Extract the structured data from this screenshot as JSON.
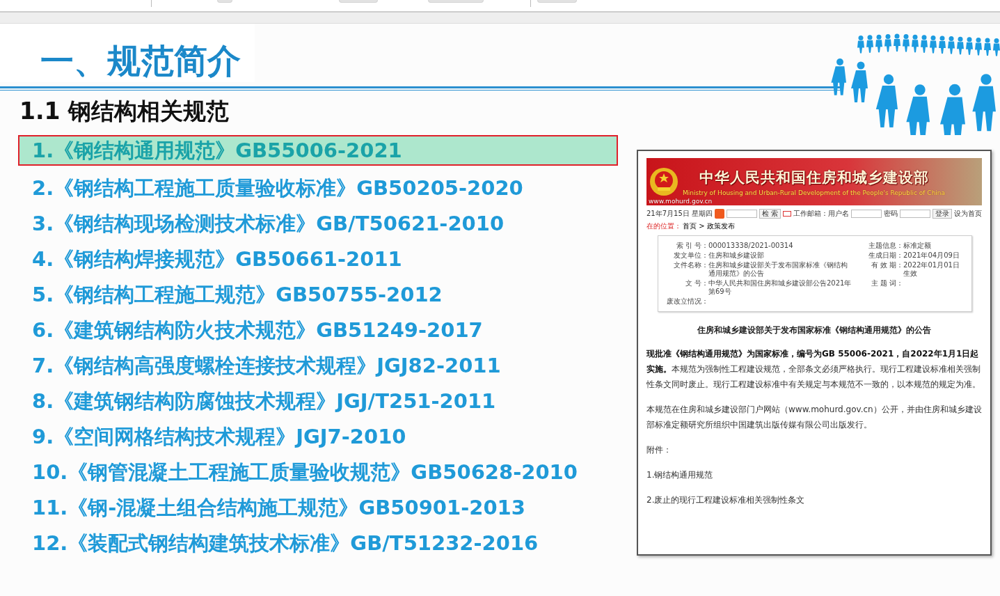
{
  "slide": {
    "title": "一、规范简介",
    "subtitle": "1.1 钢结构相关规范",
    "standards": [
      {
        "label": "1.《钢结构通用规范》GB55006-2021",
        "selected": true
      },
      {
        "label": "2.《钢结构工程施工质量验收标准》GB50205-2020",
        "selected": false
      },
      {
        "label": "3.《钢结构现场检测技术标准》GB/T50621-2010",
        "selected": false
      },
      {
        "label": "4.《钢结构焊接规范》GB50661-2011",
        "selected": false
      },
      {
        "label": "5.《钢结构工程施工规范》GB50755-2012",
        "selected": false
      },
      {
        "label": "6.《建筑钢结构防火技术规范》GB51249-2017",
        "selected": false
      },
      {
        "label": "7.《钢结构高强度螺栓连接技术规程》JGJ82-2011",
        "selected": false
      },
      {
        "label": "8.《建筑钢结构防腐蚀技术规程》JGJ/T251-2011",
        "selected": false
      },
      {
        "label": "9.《空间网格结构技术规程》JGJ7-2010",
        "selected": false
      },
      {
        "label": "10.《钢管混凝土工程施工质量验收规范》GB50628-2010",
        "selected": false
      },
      {
        "label": "11.《钢-混凝土组合结构施工规范》GB50901-2013",
        "selected": false
      },
      {
        "label": "12.《装配式钢结构建筑技术标准》GB/T51232-2016",
        "selected": false
      }
    ]
  },
  "document_screenshot": {
    "site_title": "中华人民共和国住房和城乡建设部",
    "site_subtitle": "Ministry of Housing and Urban-Rural Development of the People's Republic of China",
    "site_url": "www.mohurd.gov.cn",
    "date": "21年7月15日 星期四",
    "search_button": "检 索",
    "mail_label": "工作邮箱：用户名",
    "password_label": "密码",
    "login_button": "登录",
    "homepage_link": "设为首页",
    "breadcrumb_label": "在的位置：",
    "breadcrumb_path": "首页 > 政策发布",
    "meta_left": [
      {
        "label": "索 引 号：",
        "value": "000013338/2021-00314"
      },
      {
        "label": "发文单位：",
        "value": "住房和城乡建设部"
      },
      {
        "label": "文件名称：",
        "value": "住房和城乡建设部关于发布国家标准《钢结构通用规范》的公告"
      },
      {
        "label": "文 号：",
        "value": "中华人民共和国住房和城乡建设部公告2021年第69号"
      },
      {
        "label": "废改立情况："
      }
    ],
    "meta_right": [
      {
        "label": "主题信息：",
        "value": "标准定额"
      },
      {
        "label": "生成日期：",
        "value": "2021年04月09日"
      },
      {
        "label": "有 效 期：",
        "value": "2022年01月01日生效"
      },
      {
        "label": "主 题 词："
      }
    ],
    "notice_title": "住房和城乡建设部关于发布国家标准《钢结构通用规范》的公告",
    "paragraphs": [
      "**现批准《钢结构通用规范》为国家标准，编号为GB 55006-2021，自2022年1月1日起实施。**本规范为强制性工程建设规范，全部条文必须严格执行。现行工程建设标准相关强制性条文同时废止。现行工程建设标准中有关规定与本规范不一致的，以本规范的规定为准。",
      "本规范在住房和城乡建设部门户网站（www.mohurd.gov.cn）公开，并由住房和城乡建设部标准定额研究所组织中国建筑出版传媒有限公司出版发行。"
    ],
    "attachments_label": "附件：",
    "attachments": [
      "1.钢结构通用规范",
      "2.废止的现行工程建设标准相关强制性条文"
    ]
  }
}
